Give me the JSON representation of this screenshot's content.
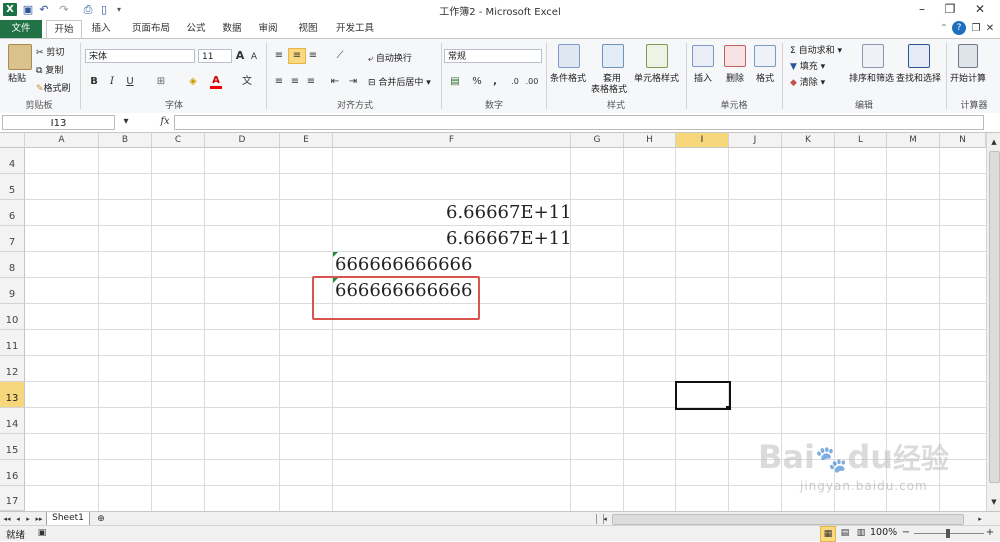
{
  "window": {
    "title": "工作簿2 - Microsoft Excel",
    "app_icon": "X",
    "buttons": [
      "–",
      "❐",
      "✕"
    ]
  },
  "ribbon_tabs": [
    "文件",
    "开始",
    "插入",
    "页面布局",
    "公式",
    "数据",
    "审阅",
    "视图",
    "开发工具"
  ],
  "ribbon": {
    "clipboard": {
      "paste": "粘贴",
      "cut": "剪切",
      "copy": "复制",
      "format_painter": "格式刷",
      "label": "剪贴板"
    },
    "font": {
      "name": "宋体",
      "size": "11",
      "bold": "B",
      "italic": "I",
      "underline": "U",
      "grow": "A",
      "shrink": "A",
      "font_color_letter": "A",
      "label": "字体"
    },
    "align": {
      "wrap": "自动换行",
      "merge": "合并后居中",
      "label": "对齐方式"
    },
    "number": {
      "format": "常规",
      "percent": "%",
      "comma": ",",
      "label": "数字"
    },
    "styles": {
      "cond": "条件格式",
      "table1": "套用",
      "table2": "表格格式",
      "cell_style": "单元格样式",
      "label": "样式"
    },
    "cells": {
      "insert": "插入",
      "delete": "删除",
      "format": "格式",
      "label": "单元格"
    },
    "editing": {
      "autosum": "自动求和",
      "fill": "填充",
      "clear": "清除",
      "sort": "排序和筛选",
      "find": "查找和选择",
      "label": "编辑"
    },
    "calc": {
      "start": "开始计算",
      "label": "计算器"
    }
  },
  "formula_bar": {
    "name_box": "I13",
    "fx": "fx",
    "value": ""
  },
  "columns": [
    "A",
    "B",
    "C",
    "D",
    "E",
    "F",
    "G",
    "H",
    "I",
    "J",
    "K",
    "L",
    "M",
    "N"
  ],
  "rows": [
    "4",
    "5",
    "6",
    "7",
    "8",
    "9",
    "10",
    "11",
    "12",
    "13",
    "14",
    "15",
    "16",
    "17"
  ],
  "selected_cell": "I13",
  "cells": {
    "F6": "6.66667E+11",
    "F7": "6.66667E+11",
    "E8": "666666666666",
    "E9": "666666666666"
  },
  "sheet": {
    "tab": "Sheet1",
    "nav": [
      "◂◂",
      "◂",
      "▸",
      "▸▸"
    ]
  },
  "status": {
    "ready": "就绪",
    "zoom": "100%",
    "minus": "−",
    "plus": "+"
  },
  "watermark": {
    "brand": "Bai",
    "brand2": "du",
    "cn": "经验",
    "url": "jingyan.baidu.com"
  }
}
